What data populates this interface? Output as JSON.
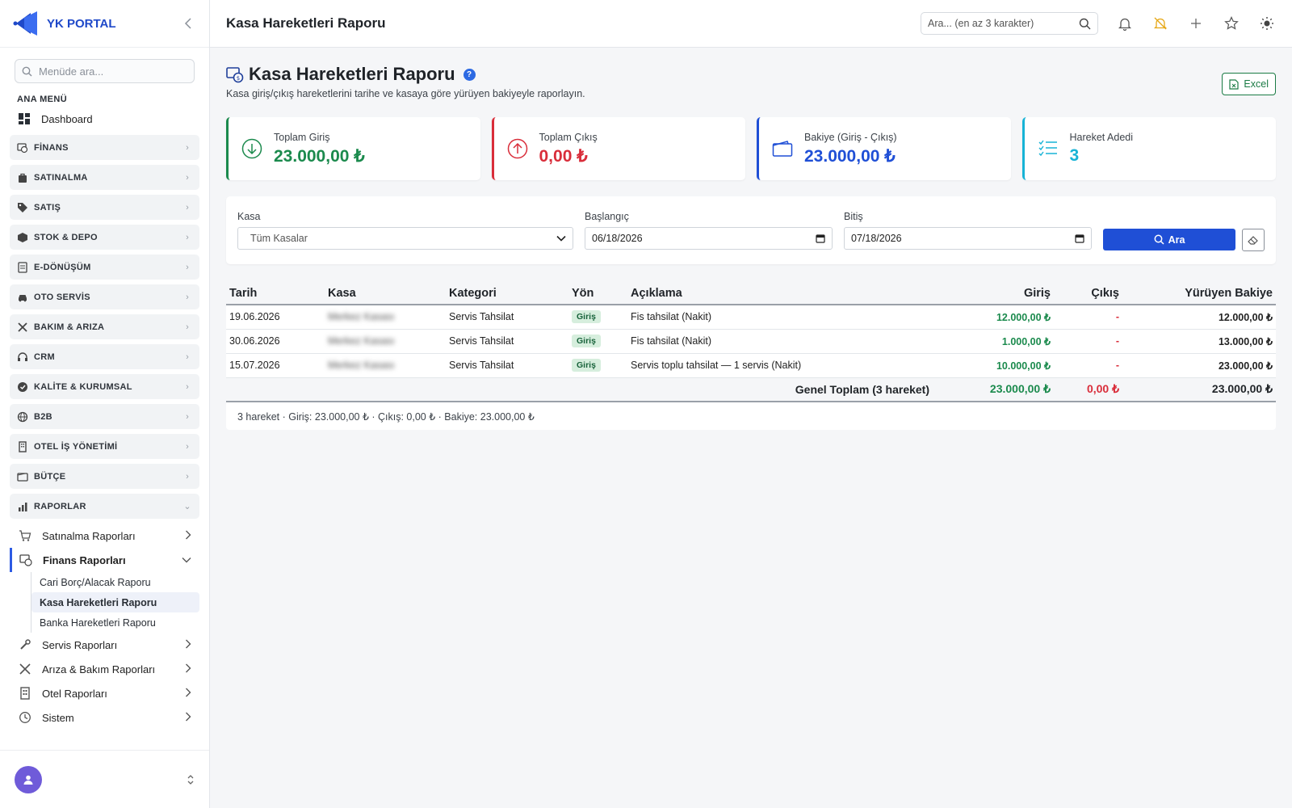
{
  "brand": {
    "name": "YK PORTAL"
  },
  "sidebar": {
    "search_placeholder": "Menüde ara...",
    "section": "ANA MENÜ",
    "dashboard": "Dashboard",
    "groups": [
      {
        "label": "FİNANS",
        "icon": "finance-icon"
      },
      {
        "label": "SATINALMA",
        "icon": "bag-icon"
      },
      {
        "label": "SATIŞ",
        "icon": "tag-icon"
      },
      {
        "label": "STOK & DEPO",
        "icon": "box-icon"
      },
      {
        "label": "E-DÖNÜŞÜM",
        "icon": "document-icon"
      },
      {
        "label": "OTO SERVİS",
        "icon": "car-icon"
      },
      {
        "label": "BAKIM & ARIZA",
        "icon": "tools-icon"
      },
      {
        "label": "CRM",
        "icon": "headset-icon"
      },
      {
        "label": "KALİTE & KURUMSAL",
        "icon": "badge-icon"
      },
      {
        "label": "B2B",
        "icon": "globe-icon"
      },
      {
        "label": "OTEL İŞ YÖNETİMİ",
        "icon": "building-icon"
      },
      {
        "label": "BÜTÇE",
        "icon": "wallet-icon"
      },
      {
        "label": "RAPORLAR",
        "icon": "chart-icon"
      }
    ],
    "reports": [
      {
        "label": "Satınalma Raporları"
      },
      {
        "label": "Finans Raporları"
      }
    ],
    "finance_leaves": [
      {
        "label": "Cari Borç/Alacak Raporu"
      },
      {
        "label": "Kasa Hareketleri Raporu"
      },
      {
        "label": "Banka Hareketleri Raporu"
      }
    ],
    "reports_after": [
      {
        "label": "Servis Raporları"
      },
      {
        "label": "Arıza & Bakım Raporları"
      },
      {
        "label": "Otel Raporları"
      },
      {
        "label": "Sistem"
      }
    ]
  },
  "topbar": {
    "title": "Kasa Hareketleri Raporu",
    "search_placeholder": "Ara... (en az 3 karakter)"
  },
  "page": {
    "title": "Kasa Hareketleri Raporu",
    "help": "?",
    "subtitle": "Kasa giriş/çıkış hareketlerini tarihe ve kasaya göre yürüyen bakiyeyle raporlayın.",
    "excel": "Excel"
  },
  "cards": [
    {
      "label": "Toplam Giriş",
      "value": "23.000,00 ₺",
      "color": "#1b8a4d"
    },
    {
      "label": "Toplam Çıkış",
      "value": "0,00 ₺",
      "color": "#d92d3a"
    },
    {
      "label": "Bakiye (Giriş - Çıkış)",
      "value": "23.000,00 ₺",
      "color": "#1f4fd6"
    },
    {
      "label": "Hareket Adedi",
      "value": "3",
      "color": "#17b3d6"
    }
  ],
  "filters": {
    "kasa_label": "Kasa",
    "kasa_value": "Tüm Kasalar",
    "start_label": "Başlangıç",
    "start_value": "06/18/2026",
    "end_label": "Bitiş",
    "end_value": "07/18/2026",
    "search_button": "Ara"
  },
  "table": {
    "headers": [
      "Tarih",
      "Kasa",
      "Kategori",
      "Yön",
      "Açıklama",
      "Giriş",
      "Çıkış",
      "Yürüyen Bakiye"
    ],
    "rows": [
      {
        "date": "19.06.2026",
        "kasa": "Merkez Kasası",
        "category": "Servis Tahsilat",
        "dir": "Giriş",
        "desc": "Fis tahsilat (Nakit)",
        "in": "12.000,00 ₺",
        "out": "-",
        "bal": "12.000,00 ₺"
      },
      {
        "date": "30.06.2026",
        "kasa": "Merkez Kasası",
        "category": "Servis Tahsilat",
        "dir": "Giriş",
        "desc": "Fis tahsilat (Nakit)",
        "in": "1.000,00 ₺",
        "out": "-",
        "bal": "13.000,00 ₺"
      },
      {
        "date": "15.07.2026",
        "kasa": "Merkez Kasası",
        "category": "Servis Tahsilat",
        "dir": "Giriş",
        "desc": "Servis toplu tahsilat — 1 servis (Nakit)",
        "in": "10.000,00 ₺",
        "out": "-",
        "bal": "23.000,00 ₺"
      }
    ],
    "footer": {
      "label": "Genel Toplam (3 hareket)",
      "in": "23.000,00 ₺",
      "out": "0,00 ₺",
      "bal": "23.000,00 ₺"
    },
    "summary": "3 hareket · Giriş: 23.000,00 ₺ · Çıkış: 0,00 ₺ · Bakiye: 23.000,00 ₺"
  }
}
